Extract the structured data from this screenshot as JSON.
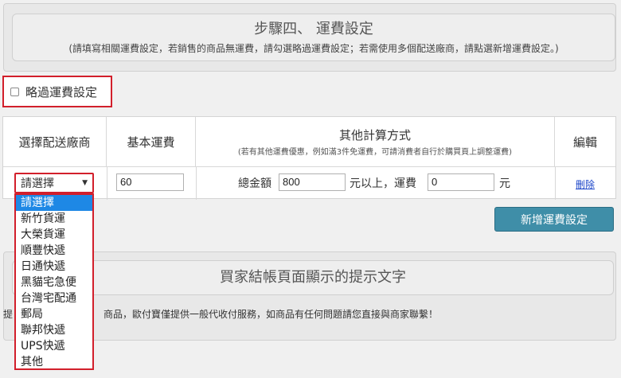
{
  "step": {
    "title": "步驟四、 運費設定",
    "note": "(請填寫相關運費設定，若銷售的商品無運費，請勾選略過運費設定；若需使用多個配送廠商，請點選新增運費設定。)"
  },
  "skip": {
    "label": "略過運費設定",
    "checked": false
  },
  "table": {
    "headers": {
      "carrier": "選擇配送廠商",
      "base_fee": "基本運費",
      "other": "其他計算方式",
      "other_note": "(若有其他運費優惠，例如滿3件免運費，可請消費者自行於購買頁上調整運費)",
      "edit": "編輯"
    },
    "row": {
      "carrier_selected": "請選擇",
      "base_fee": "60",
      "total_label": "總金額",
      "total_value": "800",
      "above_label": "元以上，運費",
      "fee_value": "0",
      "unit": "元",
      "delete": "刪除"
    }
  },
  "carrier_options": [
    "請選擇",
    "新竹貨運",
    "大榮貨運",
    "順豐快遞",
    "日通快遞",
    "黑貓宅急便",
    "台灣宅配通",
    "郵局",
    "聯邦快遞",
    "UPS快遞",
    "其他"
  ],
  "add_button": "新增運費設定",
  "hint_section": {
    "title": "買家結帳頁面顯示的提示文字",
    "hint_prefix": "提",
    "hint_text": "商品，歐付寶僅提供一般代收付服務，如商品有任何問題請您直接與商家聯繫！"
  },
  "colors": {
    "highlight": "#d21f2b",
    "button": "#3f8ea8",
    "selected_option": "#1e88e5",
    "link": "#1a44c8"
  }
}
